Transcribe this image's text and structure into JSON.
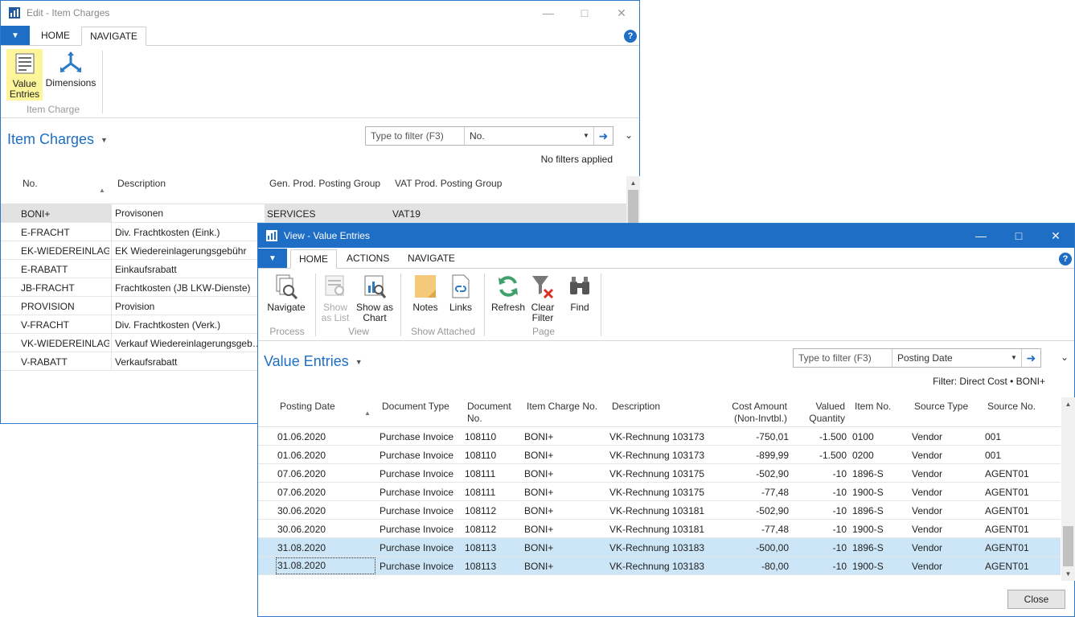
{
  "win1": {
    "title": "Edit - Item Charges",
    "tabs": [
      "HOME",
      "NAVIGATE"
    ],
    "active_tab": "NAVIGATE",
    "ribbon": {
      "value_entries_1": "Value",
      "value_entries_2": "Entries",
      "dimensions": "Dimensions",
      "group": "Item Charge"
    },
    "page_title": "Item Charges",
    "filter": {
      "placeholder": "Type to filter (F3)",
      "field": "No."
    },
    "filter_status": "No filters applied",
    "columns": [
      "No.",
      "Description",
      "Gen. Prod. Posting Group",
      "VAT Prod. Posting Group"
    ],
    "rows": [
      {
        "no": "BONI+",
        "desc": "Provisonen",
        "gen": "SERVICES",
        "vat": "VAT19"
      },
      {
        "no": "E-FRACHT",
        "desc": "Div. Frachtkosten (Eink.)",
        "gen": "",
        "vat": ""
      },
      {
        "no": "EK-WIEDEREINLAG",
        "desc": "EK Wiedereinlagerungsgebühr",
        "gen": "",
        "vat": ""
      },
      {
        "no": "E-RABATT",
        "desc": "Einkaufsrabatt",
        "gen": "",
        "vat": ""
      },
      {
        "no": "JB-FRACHT",
        "desc": "Frachtkosten (JB LKW-Dienste)",
        "gen": "",
        "vat": ""
      },
      {
        "no": "PROVISION",
        "desc": "Provision",
        "gen": "",
        "vat": ""
      },
      {
        "no": "V-FRACHT",
        "desc": "Div. Frachtkosten (Verk.)",
        "gen": "",
        "vat": ""
      },
      {
        "no": "VK-WIEDEREINLAG",
        "desc": "Verkauf Wiedereinlagerungsgeb…",
        "gen": "",
        "vat": ""
      },
      {
        "no": "V-RABATT",
        "desc": "Verkaufsrabatt",
        "gen": "",
        "vat": ""
      }
    ]
  },
  "win2": {
    "title": "View - Value Entries",
    "tabs": [
      "HOME",
      "ACTIONS",
      "NAVIGATE"
    ],
    "active_tab": "HOME",
    "ribbon": {
      "navigate": "Navigate",
      "process": "Process",
      "show_as_list_1": "Show",
      "show_as_list_2": "as List",
      "show_as_chart_1": "Show as",
      "show_as_chart_2": "Chart",
      "view": "View",
      "notes": "Notes",
      "links": "Links",
      "show_attached": "Show Attached",
      "refresh": "Refresh",
      "clear_filter_1": "Clear",
      "clear_filter_2": "Filter",
      "find": "Find",
      "page": "Page"
    },
    "page_title": "Value Entries",
    "filter": {
      "placeholder": "Type to filter (F3)",
      "field": "Posting Date"
    },
    "filter_status": "Filter: Direct Cost • BONI+",
    "columns": {
      "posting_date": "Posting Date",
      "document_type": "Document Type",
      "document_no_1": "Document",
      "document_no_2": "No.",
      "item_charge_no": "Item Charge No.",
      "description": "Description",
      "cost_amount_1": "Cost Amount",
      "cost_amount_2": "(Non-Invtbl.)",
      "valued_qty_1": "Valued",
      "valued_qty_2": "Quantity",
      "item_no": "Item No.",
      "source_type": "Source Type",
      "source_no": "Source No."
    },
    "rows": [
      {
        "date": "01.06.2020",
        "doctype": "Purchase Invoice",
        "docno": "108110",
        "charge": "BONI+",
        "desc": "VK-Rechnung 103173",
        "cost": "-750,01",
        "qty": "-1.500",
        "item": "0100",
        "stype": "Vendor",
        "sno": "001"
      },
      {
        "date": "01.06.2020",
        "doctype": "Purchase Invoice",
        "docno": "108110",
        "charge": "BONI+",
        "desc": "VK-Rechnung 103173",
        "cost": "-899,99",
        "qty": "-1.500",
        "item": "0200",
        "stype": "Vendor",
        "sno": "001"
      },
      {
        "date": "07.06.2020",
        "doctype": "Purchase Invoice",
        "docno": "108111",
        "charge": "BONI+",
        "desc": "VK-Rechnung 103175",
        "cost": "-502,90",
        "qty": "-10",
        "item": "1896-S",
        "stype": "Vendor",
        "sno": "AGENT01"
      },
      {
        "date": "07.06.2020",
        "doctype": "Purchase Invoice",
        "docno": "108111",
        "charge": "BONI+",
        "desc": "VK-Rechnung 103175",
        "cost": "-77,48",
        "qty": "-10",
        "item": "1900-S",
        "stype": "Vendor",
        "sno": "AGENT01"
      },
      {
        "date": "30.06.2020",
        "doctype": "Purchase Invoice",
        "docno": "108112",
        "charge": "BONI+",
        "desc": "VK-Rechnung 103181",
        "cost": "-502,90",
        "qty": "-10",
        "item": "1896-S",
        "stype": "Vendor",
        "sno": "AGENT01"
      },
      {
        "date": "30.06.2020",
        "doctype": "Purchase Invoice",
        "docno": "108112",
        "charge": "BONI+",
        "desc": "VK-Rechnung 103181",
        "cost": "-77,48",
        "qty": "-10",
        "item": "1900-S",
        "stype": "Vendor",
        "sno": "AGENT01"
      },
      {
        "date": "31.08.2020",
        "doctype": "Purchase Invoice",
        "docno": "108113",
        "charge": "BONI+",
        "desc": "VK-Rechnung 103183",
        "cost": "-500,00",
        "qty": "-10",
        "item": "1896-S",
        "stype": "Vendor",
        "sno": "AGENT01"
      },
      {
        "date": "31.08.2020",
        "doctype": "Purchase Invoice",
        "docno": "108113",
        "charge": "BONI+",
        "desc": "VK-Rechnung 103183",
        "cost": "-80,00",
        "qty": "-10",
        "item": "1900-S",
        "stype": "Vendor",
        "sno": "AGENT01"
      }
    ],
    "close_label": "Close"
  },
  "colors": {
    "accent": "#1d6ec4",
    "selection": "#cde6f7",
    "highlight": "#fdf59a"
  }
}
